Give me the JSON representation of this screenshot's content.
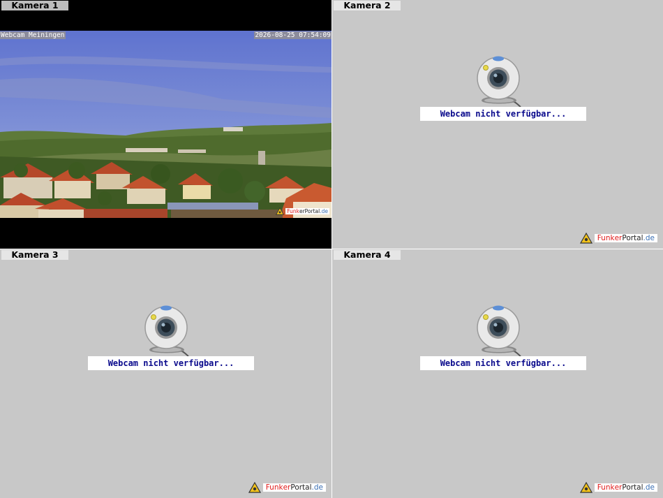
{
  "cameras": [
    {
      "label": "Kamera 1"
    },
    {
      "label": "Kamera 2"
    },
    {
      "label": "Kamera 3"
    },
    {
      "label": "Kamera 4"
    }
  ],
  "camera1": {
    "overlay_title": "Webcam Meiningen",
    "overlay_timestamp": "2026-08-25 07:54:09"
  },
  "unavailable_text": "Webcam nicht verfügbar...",
  "brand": {
    "part1": "Funk",
    "part2": "er",
    "part3": "Portal",
    "part4": ".de"
  },
  "colors": {
    "unavailable_text": "#0a0a8c",
    "panel_bg": "#c8c8c8",
    "brand_red": "#e11a1a",
    "brand_blue": "#3a6fb4"
  }
}
